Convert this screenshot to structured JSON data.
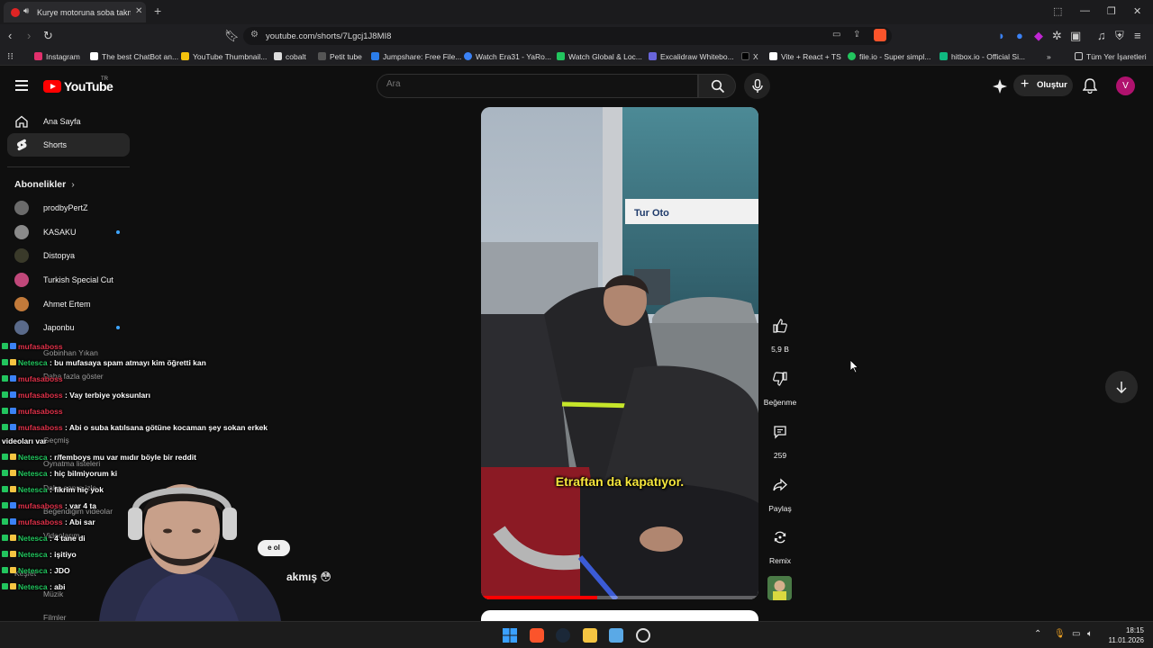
{
  "browser": {
    "tab": {
      "title": "Kurye motoruna soba takmış",
      "speaker_icon": "speaker-icon"
    },
    "url": "youtube.com/shorts/7Lgcj1J8MI8",
    "bookmarks": [
      {
        "label": "Instagram",
        "color": "#e1306c"
      },
      {
        "label": "The best ChatBot an...",
        "color": "#ffffff"
      },
      {
        "label": "YouTube Thumbnail...",
        "color": "#f4c20d"
      },
      {
        "label": "cobalt",
        "color": "#dddddd"
      },
      {
        "label": "Petit tube",
        "color": "#333333"
      },
      {
        "label": "Jumpshare: Free File...",
        "color": "#2b7de9"
      },
      {
        "label": "Watch Era31 - YaRo...",
        "color": "#3b82f6"
      },
      {
        "label": "Watch Global & Loc...",
        "color": "#22c55e"
      },
      {
        "label": "Excalidraw Whitebo...",
        "color": "#6965db"
      },
      {
        "label": "X",
        "color": "#000000"
      },
      {
        "label": "Vite + React + TS",
        "color": "#ffffff"
      },
      {
        "label": "file.io - Super simpl...",
        "color": "#22c55e"
      },
      {
        "label": "hitbox.io - Official Si...",
        "color": "#10b981"
      }
    ],
    "all_bookmarks": "Tüm Yer İşaretleri"
  },
  "youtube": {
    "logo_text": "YouTube",
    "logo_region": "TR",
    "search_placeholder": "Ara",
    "create_label": "Oluştur",
    "avatar_letter": "V"
  },
  "sidebar": {
    "items": [
      {
        "label": "Ana Sayfa",
        "icon": "home-icon"
      },
      {
        "label": "Shorts",
        "icon": "shorts-icon"
      }
    ],
    "subscriptions_title": "Abonelikler",
    "subscriptions": [
      {
        "name": "prodbyPertZ",
        "color": "#6b6b6b",
        "dot": false
      },
      {
        "name": "KASAKU",
        "color": "#8a8a8a",
        "dot": true
      },
      {
        "name": "Distopya",
        "color": "#3a3a2a",
        "dot": false
      },
      {
        "name": "Turkish Special Cut",
        "color": "#c0487a",
        "dot": false
      },
      {
        "name": "Ahmet Ertem",
        "color": "#c27a3a",
        "dot": false
      },
      {
        "name": "Japonbu",
        "color": "#5a6a8a",
        "dot": true
      }
    ],
    "ghost_items": [
      "Gobinhan Yıkan",
      "Daha fazla göster",
      "Geçmiş",
      "Oynatma listeleri",
      "Daha sonra izle",
      "Beğendiğim videolar",
      "Videolarım",
      "Keşfet",
      "Müzik",
      "Filmler"
    ]
  },
  "chat": [
    {
      "user": "mufasaboss",
      "color": "m",
      "text": ""
    },
    {
      "user": "Netesca",
      "color": "n",
      "text": "bu mufasaya spam atmayı kim öğretti kan"
    },
    {
      "user": "mufasaboss",
      "color": "m",
      "text": ""
    },
    {
      "user": "mufasaboss",
      "color": "m",
      "text": "Vay terbiye yoksunları"
    },
    {
      "user": "mufasaboss",
      "color": "m",
      "text": ""
    },
    {
      "user": "mufasaboss",
      "color": "m",
      "text": "Abi o suba katılsana götüne kocaman şey sokan erkek"
    },
    {
      "user": "",
      "color": "w",
      "text": "videoları var"
    },
    {
      "user": "Netesca",
      "color": "n",
      "text": "r/femboys mu var mıdır böyle bir reddit"
    },
    {
      "user": "Netesca",
      "color": "n",
      "text": "hiç bilmiyorum ki"
    },
    {
      "user": "Netesca",
      "color": "n",
      "text": "fikrim hiç yok"
    },
    {
      "user": "mufasaboss",
      "color": "m",
      "text": "var 4 ta"
    },
    {
      "user": "mufasaboss",
      "color": "m",
      "text": "Abi sar"
    },
    {
      "user": "Netesca",
      "color": "n",
      "text": "4 tane di"
    },
    {
      "user": "Netesca",
      "color": "n",
      "text": "işitiyo"
    },
    {
      "user": "Netesca",
      "color": "n",
      "text": "JDO"
    },
    {
      "user": "Netesca",
      "color": "n",
      "text": "abi"
    }
  ],
  "overlay_fragments": {
    "title_tail": "akmış 😳",
    "chip": "e ol"
  },
  "short": {
    "caption": "Etraftan da kapatıyor.",
    "progress": 0.42,
    "likes": "5,9 B",
    "dislike_label": "Beğenme",
    "comments": "259",
    "share_label": "Paylaş",
    "remix_label": "Remix"
  },
  "taskbar": {
    "time": "18:15",
    "date": "11.01.2026"
  }
}
